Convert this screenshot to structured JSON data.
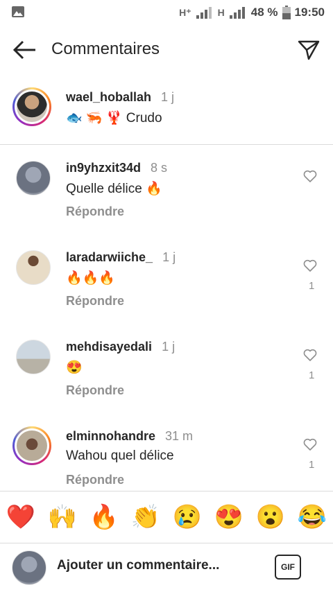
{
  "status_bar": {
    "net1": "H⁺",
    "net2": "H",
    "battery": "48 %",
    "time": "19:50"
  },
  "header": {
    "title": "Commentaires"
  },
  "caption": {
    "username": "wael_hoballah",
    "time": "1 j",
    "text": "🐟 🦐 🦞 Crudo"
  },
  "comments": [
    {
      "username": "in9yhzxit34d",
      "time": "8 s",
      "text": "Quelle délice 🔥",
      "reply": "Répondre",
      "likes": ""
    },
    {
      "username": "laradarwiiche_",
      "time": "1 j",
      "text": "🔥🔥🔥",
      "reply": "Répondre",
      "likes": "1"
    },
    {
      "username": "mehdisayedali",
      "time": "1 j",
      "text": "😍",
      "reply": "Répondre",
      "likes": "1"
    },
    {
      "username": "elminnohandre",
      "time": "31 m",
      "text": "Wahou quel délice",
      "reply": "Répondre",
      "likes": "1"
    }
  ],
  "emoji_bar": [
    "❤️",
    "🙌",
    "🔥",
    "👏",
    "😢",
    "😍",
    "😮",
    "😂"
  ],
  "input": {
    "placeholder": "Ajouter un commentaire...",
    "gif": "GIF"
  }
}
